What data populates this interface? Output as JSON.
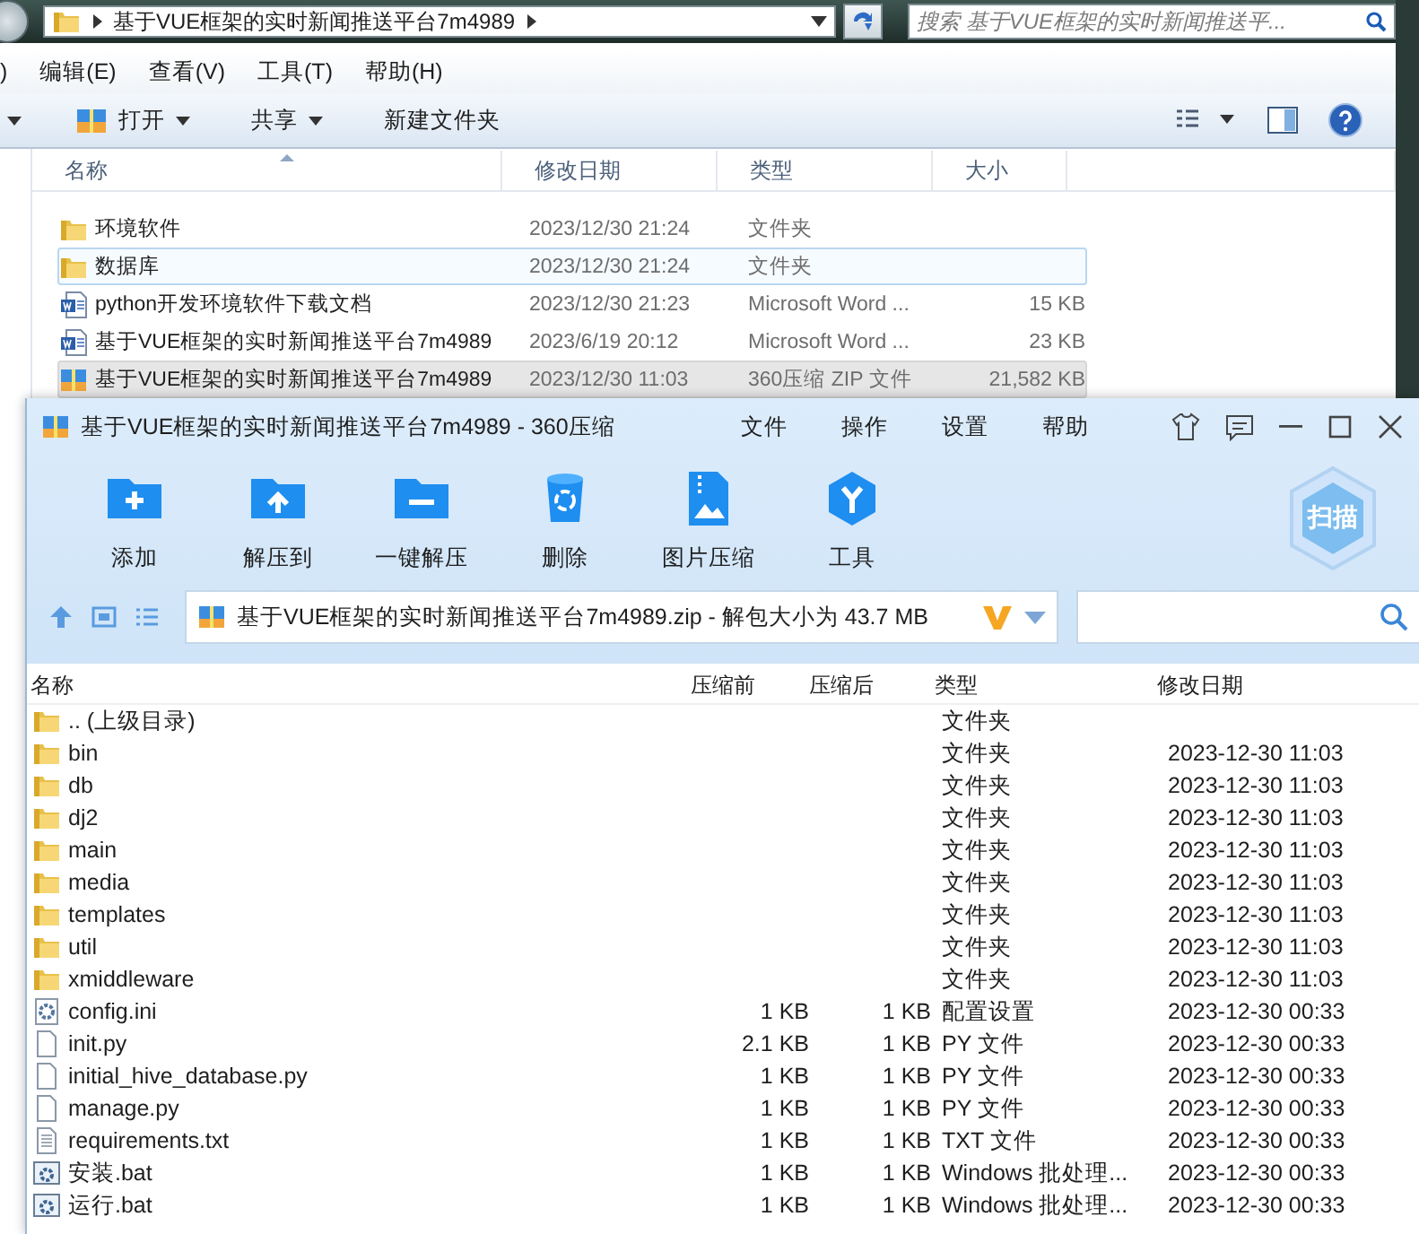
{
  "explorer": {
    "address": {
      "path": "基于VUE框架的实时新闻推送平台7m4989"
    },
    "search": {
      "placeholder": "搜索 基于VUE框架的实时新闻推送平..."
    },
    "menu": [
      ")",
      "编辑(E)",
      "查看(V)",
      "工具(T)",
      "帮助(H)"
    ],
    "toolbar": [
      {
        "label": "打开",
        "kind": "open",
        "dropdown": true
      },
      {
        "label": "共享",
        "kind": "plain",
        "dropdown": true
      },
      {
        "label": "新建文件夹",
        "kind": "plain",
        "dropdown": false
      }
    ],
    "columns": [
      "名称",
      "修改日期",
      "类型",
      "大小"
    ],
    "rows": [
      {
        "name": "环境软件",
        "date": "2023/12/30 21:24",
        "type": "文件夹",
        "kind": "folder",
        "hover": false,
        "selected": false
      },
      {
        "name": "数据库",
        "date": "2023/12/30 21:24",
        "type": "文件夹",
        "kind": "folder",
        "hover": true,
        "selected": false
      },
      {
        "name": "python开发环境软件下载文档",
        "date": "2023/12/30 21:23",
        "type": "Microsoft Word ...",
        "size": "15 KB",
        "kind": "word",
        "hover": false,
        "selected": false
      },
      {
        "name": "基于VUE框架的实时新闻推送平台7m4989",
        "date": "2023/6/19 20:12",
        "type": "Microsoft Word ...",
        "size": "23 KB",
        "kind": "word",
        "hover": false,
        "selected": false
      },
      {
        "name": "基于VUE框架的实时新闻推送平台7m4989",
        "date": "2023/12/30 11:03",
        "type": "360压缩 ZIP 文件",
        "size": "21,582 KB",
        "kind": "zip",
        "hover": false,
        "selected": true
      }
    ]
  },
  "archiver": {
    "title": "基于VUE框架的实时新闻推送平台7m4989 - 360压缩",
    "menu": [
      "文件",
      "操作",
      "设置",
      "帮助"
    ],
    "tools": [
      {
        "label": "添加",
        "kind": "add"
      },
      {
        "label": "解压到",
        "kind": "extract"
      },
      {
        "label": "一键解压",
        "kind": "onekey"
      },
      {
        "label": "删除",
        "kind": "delete"
      },
      {
        "label": "图片压缩",
        "kind": "image"
      },
      {
        "label": "工具",
        "kind": "tools"
      }
    ],
    "scan": "扫描",
    "path": "基于VUE框架的实时新闻推送平台7m4989.zip - 解包大小为 43.7 MB",
    "columns": [
      "名称",
      "压缩前",
      "压缩后",
      "类型",
      "修改日期"
    ],
    "rows": [
      {
        "name": ".. (上级目录)",
        "type": "文件夹",
        "kind": "folder"
      },
      {
        "name": "bin",
        "type": "文件夹",
        "date": "2023-12-30 11:03",
        "kind": "folder"
      },
      {
        "name": "db",
        "type": "文件夹",
        "date": "2023-12-30 11:03",
        "kind": "folder"
      },
      {
        "name": "dj2",
        "type": "文件夹",
        "date": "2023-12-30 11:03",
        "kind": "folder"
      },
      {
        "name": "main",
        "type": "文件夹",
        "date": "2023-12-30 11:03",
        "kind": "folder"
      },
      {
        "name": "media",
        "type": "文件夹",
        "date": "2023-12-30 11:03",
        "kind": "folder"
      },
      {
        "name": "templates",
        "type": "文件夹",
        "date": "2023-12-30 11:03",
        "kind": "folder"
      },
      {
        "name": "util",
        "type": "文件夹",
        "date": "2023-12-30 11:03",
        "kind": "folder"
      },
      {
        "name": "xmiddleware",
        "type": "文件夹",
        "date": "2023-12-30 11:03",
        "kind": "folder"
      },
      {
        "name": "config.ini",
        "before": "1 KB",
        "after": "1 KB",
        "type": "配置设置",
        "date": "2023-12-30 00:33",
        "kind": "settings"
      },
      {
        "name": "init.py",
        "before": "2.1 KB",
        "after": "1 KB",
        "type": "PY 文件",
        "date": "2023-12-30 00:33",
        "kind": "file"
      },
      {
        "name": "initial_hive_database.py",
        "before": "1 KB",
        "after": "1 KB",
        "type": "PY 文件",
        "date": "2023-12-30 00:33",
        "kind": "file"
      },
      {
        "name": "manage.py",
        "before": "1 KB",
        "after": "1 KB",
        "type": "PY 文件",
        "date": "2023-12-30 00:33",
        "kind": "file"
      },
      {
        "name": "requirements.txt",
        "before": "1 KB",
        "after": "1 KB",
        "type": "TXT 文件",
        "date": "2023-12-30 00:33",
        "kind": "text"
      },
      {
        "name": "安装.bat",
        "before": "1 KB",
        "after": "1 KB",
        "type": "Windows 批处理...",
        "date": "2023-12-30 00:33",
        "kind": "batch"
      },
      {
        "name": "运行.bat",
        "before": "1 KB",
        "after": "1 KB",
        "type": "Windows 批处理...",
        "date": "2023-12-30 00:33",
        "kind": "batch"
      }
    ]
  }
}
